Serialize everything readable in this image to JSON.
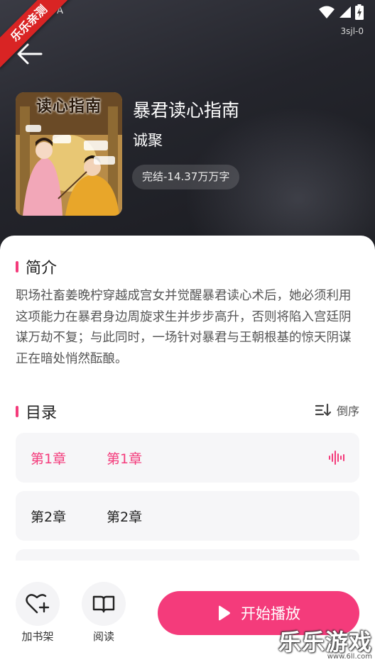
{
  "status_bar": {
    "left_glyph": "A",
    "sub_label": "3sjl-0"
  },
  "promo_ribbon": {
    "text": "乐乐亲测"
  },
  "book": {
    "cover_title": "读心指南",
    "title": "暴君读心指南",
    "author": "诚聚",
    "tag": "完结-14.37万万字"
  },
  "intro": {
    "heading": "简介",
    "text": "职场社畜姜晚柠穿越成宫女并觉醒暴君读心术后，她必须利用这项能力在暴君身边周旋求生并步步高升，否则将陷入宫廷阴谋万劫不复；与此同时，一场针对暴君与王朝根基的惊天阴谋正在暗处悄然酝酿。"
  },
  "catalog": {
    "heading": "目录",
    "sort_label": "倒序",
    "chapters": [
      {
        "num": "第1章",
        "name": "第1章",
        "active": true
      },
      {
        "num": "第2章",
        "name": "第2章",
        "active": false
      }
    ]
  },
  "bottom": {
    "shelf_label": "加书架",
    "read_label": "阅读",
    "play_label": "开始播放"
  },
  "watermark": {
    "main": "乐乐游戏",
    "sub": "www.6ll.com"
  },
  "colors": {
    "accent": "#f43b7b",
    "header_bg": "#24252c",
    "ribbon": "#d92424"
  },
  "icons": [
    "back-arrow-icon",
    "wifi-icon",
    "signal-icon",
    "battery-icon",
    "sort-icon",
    "audio-wave-icon",
    "heart-plus-icon",
    "book-open-icon",
    "play-icon"
  ]
}
